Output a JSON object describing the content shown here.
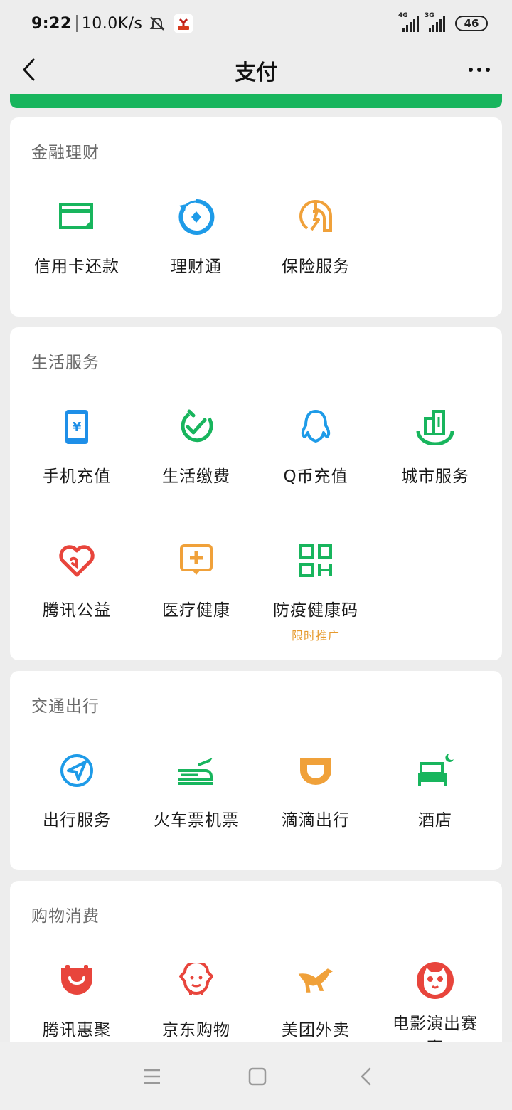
{
  "status_bar": {
    "time": "9:22",
    "speed": "10.0K/s",
    "net1": "4G",
    "net2": "3G",
    "battery": "46"
  },
  "nav": {
    "title": "支付"
  },
  "sections": [
    {
      "title": "金融理财",
      "items": [
        {
          "label": "信用卡还款",
          "icon": "credit-card-icon",
          "color": "#18b55d"
        },
        {
          "label": "理财通",
          "icon": "wealth-icon",
          "color": "#1e9be8"
        },
        {
          "label": "保险服务",
          "icon": "insurance-icon",
          "color": "#f0a13a"
        }
      ]
    },
    {
      "title": "生活服务",
      "items": [
        {
          "label": "手机充值",
          "icon": "phone-recharge-icon",
          "color": "#1e8fe8"
        },
        {
          "label": "生活缴费",
          "icon": "utility-payment-icon",
          "color": "#18b55d"
        },
        {
          "label": "Q币充值",
          "icon": "qq-coin-icon",
          "color": "#1e9be8"
        },
        {
          "label": "城市服务",
          "icon": "city-service-icon",
          "color": "#18b55d"
        },
        {
          "label": "腾讯公益",
          "icon": "charity-heart-icon",
          "color": "#e8453c"
        },
        {
          "label": "医疗健康",
          "icon": "medical-icon",
          "color": "#f0a13a"
        },
        {
          "label": "防疫健康码",
          "icon": "qr-code-icon",
          "color": "#18b55d",
          "sub": "限时推广"
        }
      ]
    },
    {
      "title": "交通出行",
      "items": [
        {
          "label": "出行服务",
          "icon": "navigation-icon",
          "color": "#1e9be8"
        },
        {
          "label": "火车票机票",
          "icon": "train-plane-icon",
          "color": "#18b55d"
        },
        {
          "label": "滴滴出行",
          "icon": "didi-icon",
          "color": "#f0a13a"
        },
        {
          "label": "酒店",
          "icon": "hotel-bed-icon",
          "color": "#18b55d"
        }
      ]
    },
    {
      "title": "购物消费",
      "items": [
        {
          "label": "腾讯惠聚",
          "icon": "tencent-huiju-icon",
          "color": "#e8453c"
        },
        {
          "label": "京东购物",
          "icon": "jd-dog-icon",
          "color": "#e8453c"
        },
        {
          "label": "美团外卖",
          "icon": "meituan-kangaroo-icon",
          "color": "#f0a13a"
        },
        {
          "label": "电影演出赛事",
          "icon": "maoyan-cat-icon",
          "color": "#e8453c"
        }
      ]
    }
  ]
}
